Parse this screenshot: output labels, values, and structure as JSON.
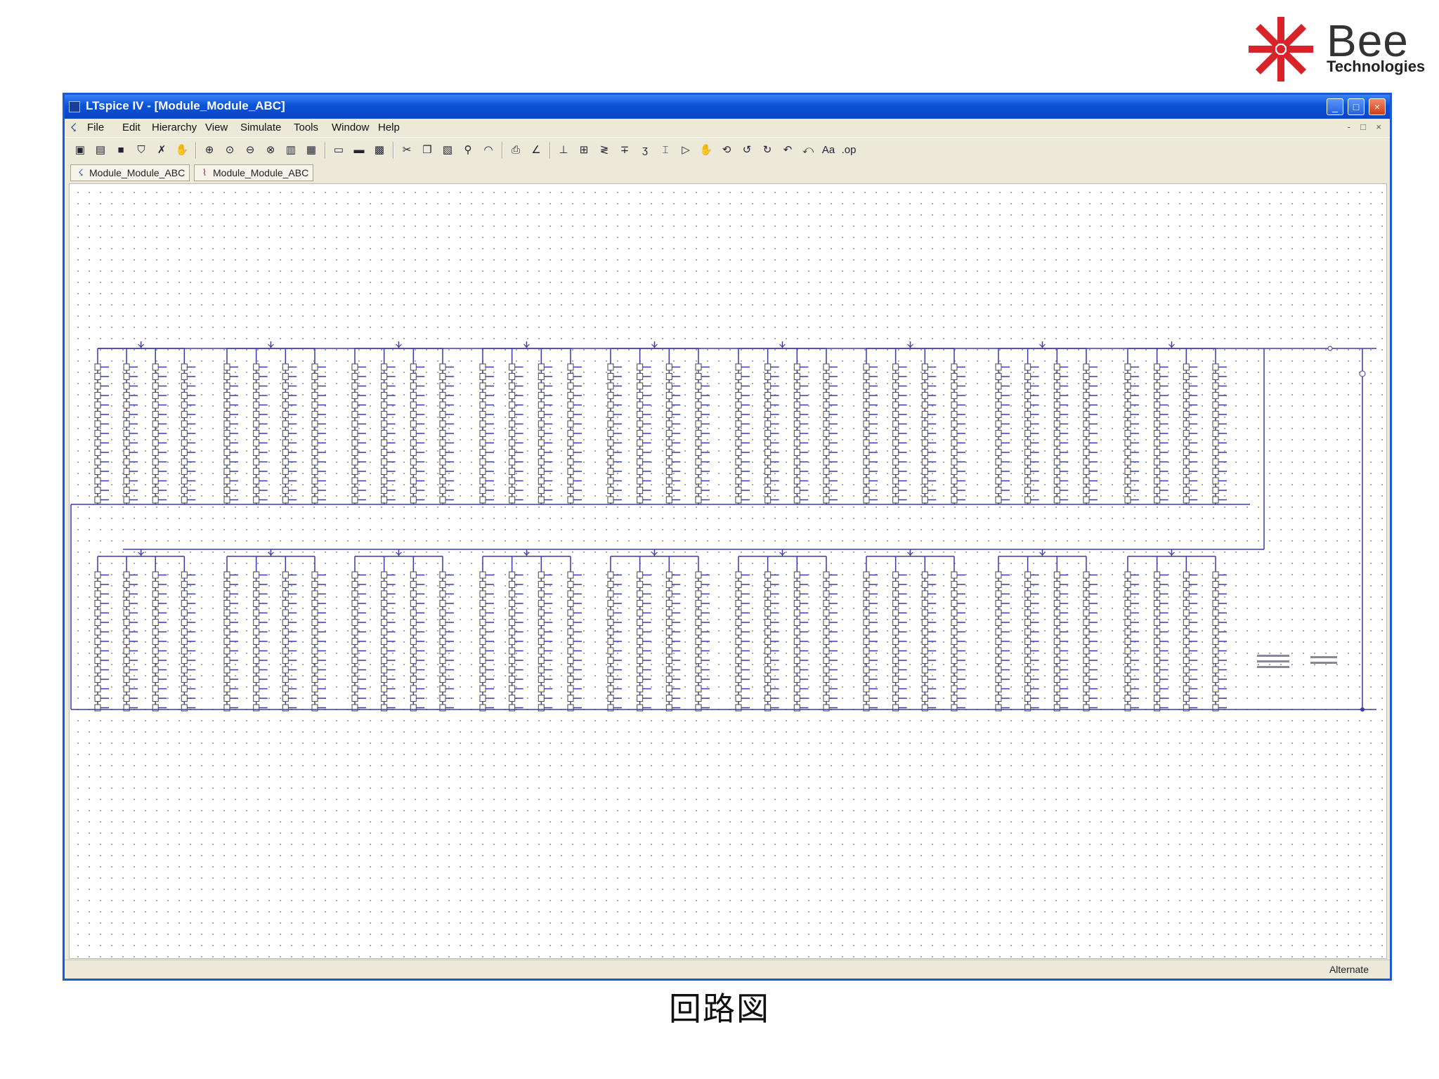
{
  "logo": {
    "brand": "Bee",
    "subtitle": "Technologies"
  },
  "window": {
    "title": "LTspice IV - [Module_Module_ABC]",
    "buttons": {
      "minimize": "_",
      "maximize": "□",
      "close": "×"
    }
  },
  "menu": [
    "File",
    "Edit",
    "Hierarchy",
    "View",
    "Simulate",
    "Tools",
    "Window",
    "Help"
  ],
  "mdi_controls": [
    "-",
    "□",
    "×"
  ],
  "toolbar_icons": [
    "new-schematic-icon",
    "open-icon",
    "save-icon",
    "control-panel-icon",
    "run-icon",
    "halt-icon",
    "zoom-in-icon",
    "zoom-pan-icon",
    "zoom-out-icon",
    "zoom-fit-icon",
    "autorange-icon",
    "properties-icon",
    "tile-horizontal-icon",
    "cascade-icon",
    "close-window-icon",
    "cut-icon",
    "copy-icon",
    "paste-icon",
    "find-icon",
    "print-preview-icon",
    "print-icon",
    "wire-icon",
    "ground-icon",
    "label-net-icon",
    "resistor-icon",
    "capacitor-icon",
    "inductor-icon",
    "diode-icon",
    "component-icon",
    "move-icon",
    "drag-icon",
    "undo-icon",
    "redo-icon",
    "rotate-icon",
    "mirror-icon",
    "text-icon",
    "spice-directive-icon"
  ],
  "toolbar_glyphs": [
    "▣",
    "▤",
    "■",
    "⛉",
    "✗",
    "✋",
    "⊕",
    "⊙",
    "⊖",
    "⊗",
    "▥",
    "▦",
    "▭",
    "▬",
    "▩",
    "✂",
    "❐",
    "▧",
    "⚲",
    "◠",
    "⎙",
    "∠",
    "⊥",
    "⊞",
    "≷",
    "∓",
    "ʒ",
    "⌶",
    "▷",
    "✋",
    "⟲",
    "↺",
    "↻",
    "↶",
    "⤺",
    "Aa",
    ".op"
  ],
  "tabs": [
    {
      "label": "Module_Module_ABC",
      "icon": "schematic-tab-icon",
      "glyph": "☇"
    },
    {
      "label": "Module_Module_ABC",
      "icon": "waveform-tab-icon",
      "glyph": "📈"
    }
  ],
  "status": {
    "text": "Alternate"
  },
  "caption": "回路図",
  "colors": {
    "wire": "#3a3aa8",
    "component": "#555555",
    "titlebar": "#0a52d6"
  }
}
